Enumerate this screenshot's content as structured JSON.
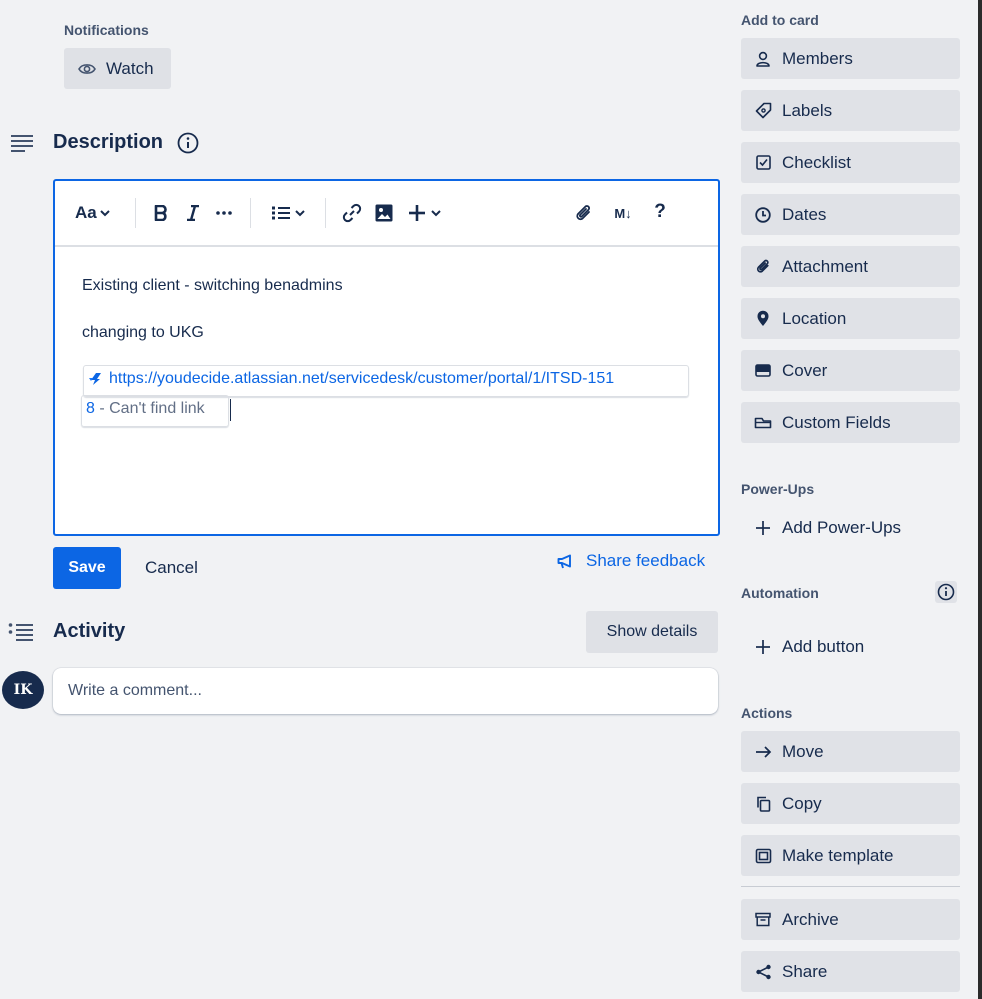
{
  "notifications": {
    "label": "Notifications",
    "watch_label": "Watch"
  },
  "description": {
    "title": "Description",
    "toolbar": {
      "text_style": "Aa",
      "markdown": "M↓",
      "help": "?"
    },
    "content": {
      "paragraph1": "Existing client - switching benadmins",
      "paragraph2": "changing to UKG",
      "link_line1": "https://youdecide.atlassian.net/servicedesk/customer/portal/1/ITSD-151",
      "link_line2_number": "8",
      "link_line2_title": " - Can't find link"
    },
    "save_label": "Save",
    "cancel_label": "Cancel",
    "feedback_label": "Share feedback"
  },
  "activity": {
    "title": "Activity",
    "show_details_label": "Show details",
    "avatar_initials": "IK",
    "comment_placeholder": "Write a comment..."
  },
  "sidebar": {
    "add_to_card_label": "Add to card",
    "add_to_card": [
      {
        "label": "Members",
        "icon": "person-icon"
      },
      {
        "label": "Labels",
        "icon": "tag-icon"
      },
      {
        "label": "Checklist",
        "icon": "checkbox-icon"
      },
      {
        "label": "Dates",
        "icon": "clock-icon"
      },
      {
        "label": "Attachment",
        "icon": "paperclip-icon"
      },
      {
        "label": "Location",
        "icon": "location-pin-icon"
      },
      {
        "label": "Cover",
        "icon": "card-cover-icon"
      },
      {
        "label": "Custom Fields",
        "icon": "custom-field-icon"
      }
    ],
    "power_ups_label": "Power-Ups",
    "add_power_ups_label": "Add Power-Ups",
    "automation_label": "Automation",
    "add_button_label": "Add button",
    "actions_label": "Actions",
    "actions": [
      {
        "label": "Move",
        "icon": "arrow-right-icon"
      },
      {
        "label": "Copy",
        "icon": "copy-icon"
      },
      {
        "label": "Make template",
        "icon": "template-icon"
      },
      {
        "label": "Archive",
        "icon": "archive-icon"
      },
      {
        "label": "Share",
        "icon": "share-icon"
      }
    ]
  },
  "colors": {
    "background": "#f1f2f4",
    "accent": "#0c66e4",
    "button_bg": "#dfe1e6",
    "text": "#172b4d"
  }
}
